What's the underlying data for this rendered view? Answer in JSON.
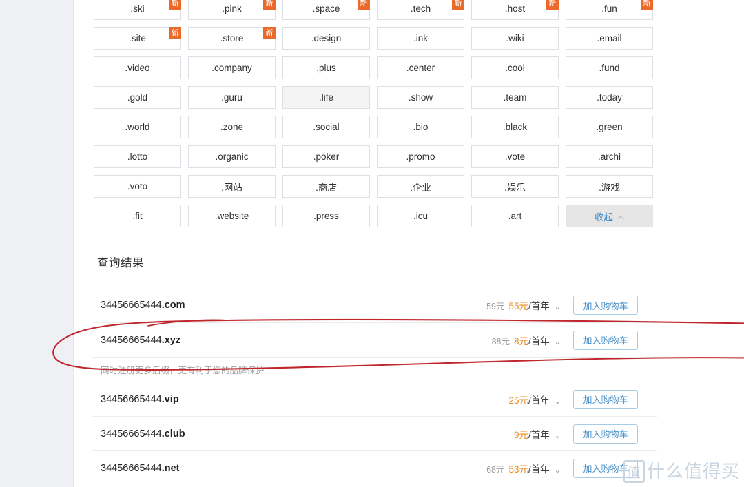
{
  "tld_grid": {
    "rows": [
      [
        {
          "label": ".ski",
          "badge": "新",
          "highlighted": false
        },
        {
          "label": ".pink",
          "badge": "新",
          "highlighted": false
        },
        {
          "label": ".space",
          "badge": "新",
          "highlighted": false
        },
        {
          "label": ".tech",
          "badge": "新",
          "highlighted": false
        },
        {
          "label": ".host",
          "badge": "新",
          "highlighted": false
        },
        {
          "label": ".fun",
          "badge": "新",
          "highlighted": false
        }
      ],
      [
        {
          "label": ".site",
          "badge": "新",
          "highlighted": false
        },
        {
          "label": ".store",
          "badge": "新",
          "highlighted": false
        },
        {
          "label": ".design",
          "badge": "",
          "highlighted": false
        },
        {
          "label": ".ink",
          "badge": "",
          "highlighted": false
        },
        {
          "label": ".wiki",
          "badge": "",
          "highlighted": false
        },
        {
          "label": ".email",
          "badge": "",
          "highlighted": false
        }
      ],
      [
        {
          "label": ".video",
          "badge": "",
          "highlighted": false
        },
        {
          "label": ".company",
          "badge": "",
          "highlighted": false
        },
        {
          "label": ".plus",
          "badge": "",
          "highlighted": false
        },
        {
          "label": ".center",
          "badge": "",
          "highlighted": false
        },
        {
          "label": ".cool",
          "badge": "",
          "highlighted": false
        },
        {
          "label": ".fund",
          "badge": "",
          "highlighted": false
        }
      ],
      [
        {
          "label": ".gold",
          "badge": "",
          "highlighted": false
        },
        {
          "label": ".guru",
          "badge": "",
          "highlighted": false
        },
        {
          "label": ".life",
          "badge": "",
          "highlighted": true
        },
        {
          "label": ".show",
          "badge": "",
          "highlighted": false
        },
        {
          "label": ".team",
          "badge": "",
          "highlighted": false
        },
        {
          "label": ".today",
          "badge": "",
          "highlighted": false
        }
      ],
      [
        {
          "label": ".world",
          "badge": "",
          "highlighted": false
        },
        {
          "label": ".zone",
          "badge": "",
          "highlighted": false
        },
        {
          "label": ".social",
          "badge": "",
          "highlighted": false
        },
        {
          "label": ".bio",
          "badge": "",
          "highlighted": false
        },
        {
          "label": ".black",
          "badge": "",
          "highlighted": false
        },
        {
          "label": ".green",
          "badge": "",
          "highlighted": false
        }
      ],
      [
        {
          "label": ".lotto",
          "badge": "",
          "highlighted": false
        },
        {
          "label": ".organic",
          "badge": "",
          "highlighted": false
        },
        {
          "label": ".poker",
          "badge": "",
          "highlighted": false
        },
        {
          "label": ".promo",
          "badge": "",
          "highlighted": false
        },
        {
          "label": ".vote",
          "badge": "",
          "highlighted": false
        },
        {
          "label": ".archi",
          "badge": "",
          "highlighted": false
        }
      ],
      [
        {
          "label": ".voto",
          "badge": "",
          "highlighted": false
        },
        {
          "label": ".网站",
          "badge": "",
          "highlighted": false
        },
        {
          "label": ".商店",
          "badge": "",
          "highlighted": false
        },
        {
          "label": ".企业",
          "badge": "",
          "highlighted": false
        },
        {
          "label": ".娱乐",
          "badge": "",
          "highlighted": false
        },
        {
          "label": ".游戏",
          "badge": "",
          "highlighted": false
        }
      ],
      [
        {
          "label": ".fit",
          "badge": "",
          "highlighted": false
        },
        {
          "label": ".website",
          "badge": "",
          "highlighted": false
        },
        {
          "label": ".press",
          "badge": "",
          "highlighted": false
        },
        {
          "label": ".icu",
          "badge": "",
          "highlighted": false
        },
        {
          "label": ".art",
          "badge": "",
          "highlighted": false
        }
      ]
    ],
    "collapse_button": {
      "label": "收起",
      "chevron": "︿"
    }
  },
  "results": {
    "title": "查询结果",
    "cart_button_label": "加入购物车",
    "price_chevron": "⌄",
    "hint_text": "同时注册更多后缀，更有利于您的品牌保护",
    "items": [
      {
        "sld": "34456665444",
        "tld": ".com",
        "old_price": "59元",
        "price": "55元",
        "unit": "/首年",
        "has_hint": false,
        "annotated": false
      },
      {
        "sld": "34456665444",
        "tld": ".xyz",
        "old_price": "88元",
        "price": "8元",
        "unit": "/首年",
        "has_hint": true,
        "annotated": true
      },
      {
        "sld": "34456665444",
        "tld": ".vip",
        "old_price": "",
        "price": "25元",
        "unit": "/首年",
        "has_hint": false,
        "annotated": false
      },
      {
        "sld": "34456665444",
        "tld": ".club",
        "old_price": "",
        "price": "9元",
        "unit": "/首年",
        "has_hint": false,
        "annotated": false
      },
      {
        "sld": "34456665444",
        "tld": ".net",
        "old_price": "68元",
        "price": "53元",
        "unit": "/首年",
        "has_hint": false,
        "annotated": false
      }
    ]
  },
  "watermark": {
    "mark": "值",
    "text": "什么值得买"
  },
  "colors": {
    "accent_orange": "#ec6a29",
    "price_orange": "#e98a1f",
    "link_blue": "#4a90c8",
    "annotation_red": "#c0272d",
    "page_gray": "#eff0f4"
  }
}
